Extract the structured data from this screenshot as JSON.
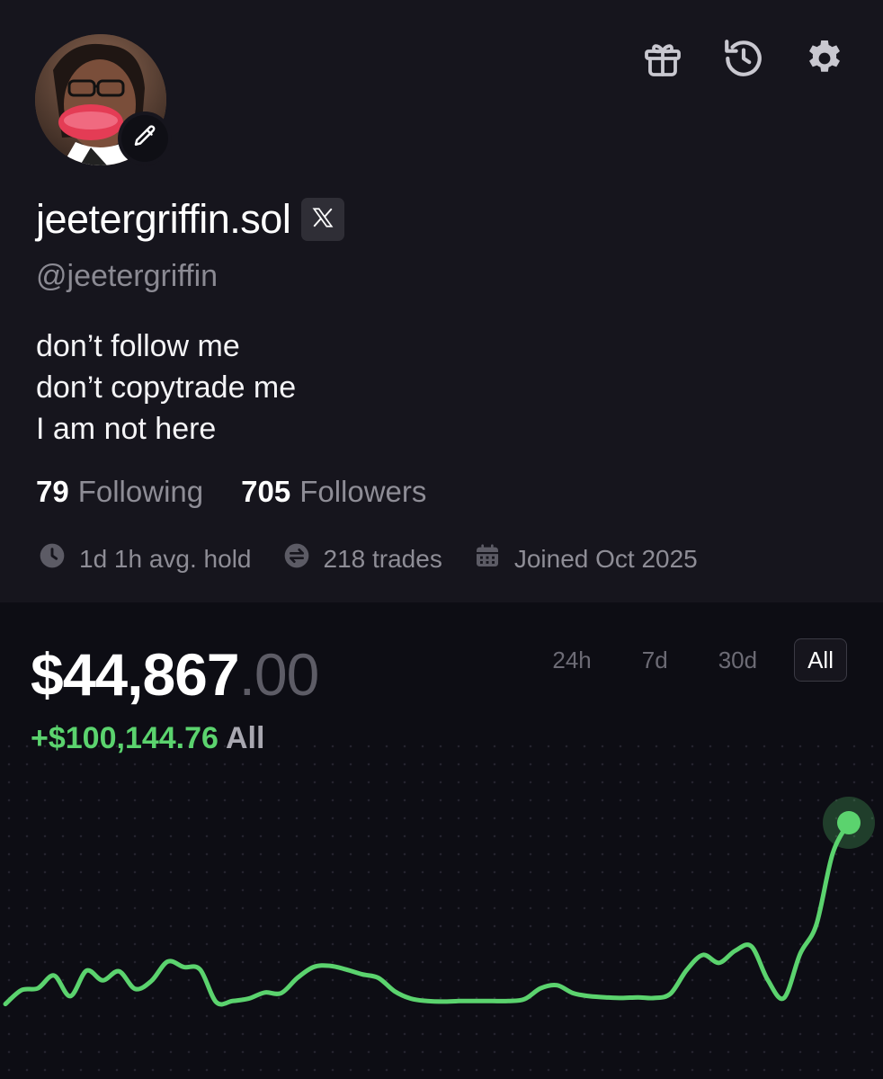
{
  "profile": {
    "display_name": "jeetergriffin.sol",
    "handle": "@jeetergriffin",
    "bio_lines": [
      "don’t follow me",
      "don’t copytrade me",
      "I am not here"
    ],
    "following_count": "79",
    "following_label": "Following",
    "followers_count": "705",
    "followers_label": "Followers",
    "avg_hold": "1d 1h avg. hold",
    "trades": "218 trades",
    "joined": "Joined Oct 2025"
  },
  "header_icons": [
    "gift-icon",
    "history-icon",
    "gear-icon"
  ],
  "portfolio": {
    "balance_whole": "$44,867",
    "balance_cents": ".00",
    "change_amount": "+$100,144.76",
    "change_period": "All",
    "ranges": [
      "24h",
      "7d",
      "30d",
      "All"
    ],
    "selected_range": "All"
  },
  "colors": {
    "accent_green": "#5bd36e",
    "background": "#0d0d14",
    "card": "#16151d"
  },
  "chart_data": {
    "type": "line",
    "series": [
      {
        "values": [
          5,
          28,
          31,
          52,
          18,
          60,
          44,
          59,
          30,
          43,
          75,
          66,
          62,
          8,
          10,
          14,
          24,
          23,
          48,
          66,
          68,
          62,
          54,
          48,
          26,
          14,
          10,
          9,
          10,
          10,
          10,
          10,
          13,
          31,
          36,
          23,
          18,
          16,
          15,
          16,
          15,
          22,
          61,
          86,
          73,
          93,
          100,
          45,
          15,
          88,
          136,
          253,
          304
        ]
      }
    ],
    "grid": true,
    "end_marker": true
  }
}
